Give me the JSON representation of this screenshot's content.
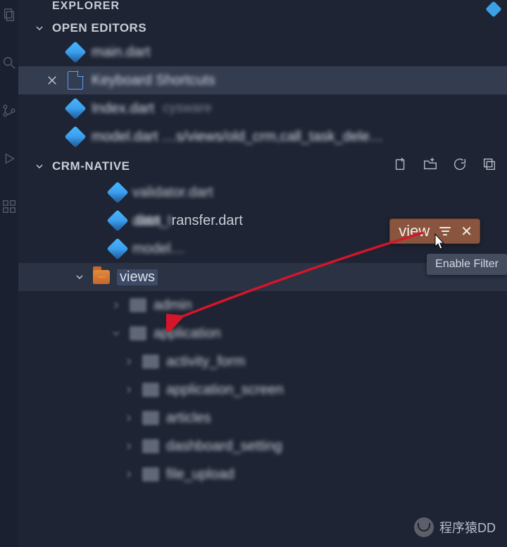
{
  "sidebar_title": "EXPLORER",
  "open_editors_title": "OPEN EDITORS",
  "project_title": "CRM-NATIVE",
  "open_editors": [
    {
      "label": "main.dart",
      "icon": "dart",
      "blurred": true
    },
    {
      "label": "Keyboard Shortcuts",
      "icon": "page",
      "active": true,
      "blurred": true
    },
    {
      "label": "Index.dart",
      "hint": "cysware",
      "icon": "dart",
      "blurred": true
    },
    {
      "label": "model.dart …s/views/old_crm,call_task_dele…",
      "icon": "dart",
      "blurred": true
    }
  ],
  "tree": [
    {
      "level": 1,
      "icon": "dart",
      "label": "validator.dart",
      "blurred": true
    },
    {
      "level": 1,
      "icon": "dart",
      "label": "data_transfer.dart",
      "blurred": false
    },
    {
      "level": 1,
      "icon": "dart",
      "label": "model…",
      "blurred": true
    },
    {
      "level": 0,
      "chev": "down",
      "icon": "folder-open",
      "label": "views",
      "highlight": true,
      "label_highlight": true
    },
    {
      "level": 1,
      "chev": "right",
      "icon": "folder",
      "label": "admin",
      "blurred": true
    },
    {
      "level": 1,
      "chev": "down",
      "icon": "folder",
      "label": "application",
      "blurred": true
    },
    {
      "level": 2,
      "chev": "right",
      "icon": "folder",
      "label": "activity_form",
      "blurred": true
    },
    {
      "level": 2,
      "chev": "right",
      "icon": "folder",
      "label": "application_screen",
      "blurred": true
    },
    {
      "level": 2,
      "chev": "right",
      "icon": "folder",
      "label": "articles",
      "blurred": true
    },
    {
      "level": 2,
      "chev": "right",
      "icon": "folder",
      "label": "dashboard_setting",
      "blurred": true
    },
    {
      "level": 2,
      "chev": "right",
      "icon": "folder",
      "label": "file_upload",
      "blurred": true
    }
  ],
  "filter": {
    "text": "view",
    "tooltip": "Enable Filter"
  },
  "watermark": "程序猿DD"
}
